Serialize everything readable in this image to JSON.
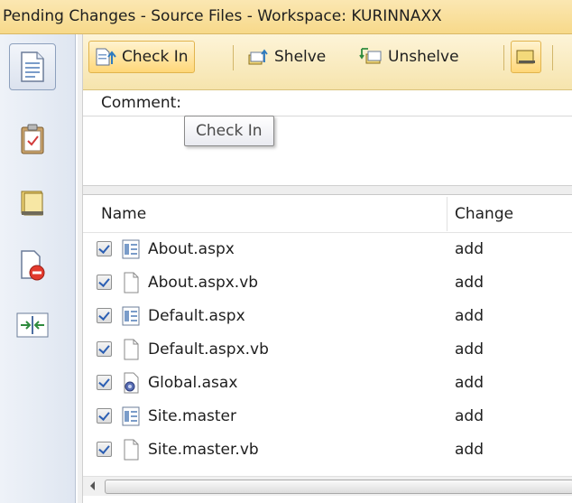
{
  "window": {
    "title": "Pending Changes - Source Files - Workspace: KURINNAXX"
  },
  "leftbar": {
    "items": [
      {
        "icon": "source-files-icon",
        "active": true
      },
      {
        "icon": "work-items-icon",
        "active": false
      },
      {
        "icon": "check-in-notes-icon",
        "active": false
      },
      {
        "icon": "policy-warnings-icon",
        "active": false
      },
      {
        "icon": "conflicts-icon",
        "active": false
      }
    ]
  },
  "toolbar": {
    "checkin_label": "Check In",
    "shelve_label": "Shelve",
    "unshelve_label": "Unshelve"
  },
  "comment": {
    "label": "Comment:",
    "value": ""
  },
  "tooltip": {
    "text": "Check In"
  },
  "table": {
    "columns": [
      "Name",
      "Change"
    ],
    "rows": [
      {
        "name": "About.aspx",
        "change": "add",
        "icon": "aspx-file-icon",
        "checked": true
      },
      {
        "name": "About.aspx.vb",
        "change": "add",
        "icon": "vb-file-icon",
        "checked": true
      },
      {
        "name": "Default.aspx",
        "change": "add",
        "icon": "aspx-file-icon",
        "checked": true
      },
      {
        "name": "Default.aspx.vb",
        "change": "add",
        "icon": "vb-file-icon",
        "checked": true
      },
      {
        "name": "Global.asax",
        "change": "add",
        "icon": "asax-file-icon",
        "checked": true
      },
      {
        "name": "Site.master",
        "change": "add",
        "icon": "master-file-icon",
        "checked": true
      },
      {
        "name": "Site.master.vb",
        "change": "add",
        "icon": "vb-file-icon",
        "checked": true
      }
    ]
  }
}
